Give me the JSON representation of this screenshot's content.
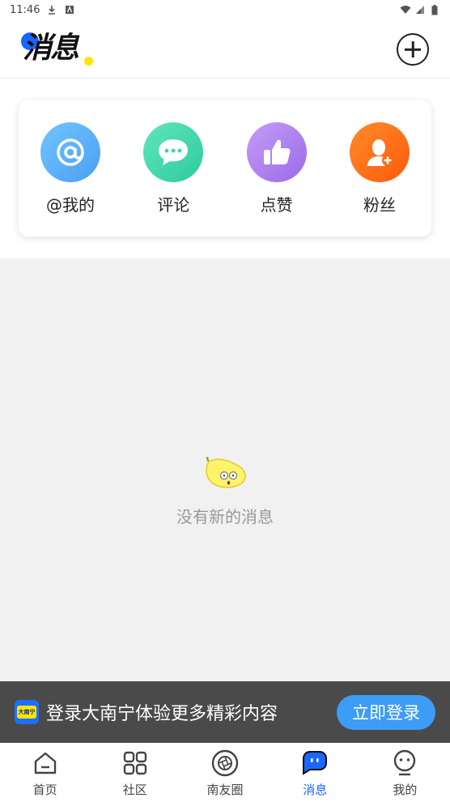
{
  "status_bar": {
    "time": "11:46"
  },
  "header": {
    "title": "消息",
    "add_icon": "plus-circle-icon"
  },
  "categories": [
    {
      "label": "@我的",
      "icon": "at-icon",
      "color": "#5aaef7"
    },
    {
      "label": "评论",
      "icon": "comment-bubble-icon",
      "color": "#3fd6a9"
    },
    {
      "label": "点赞",
      "icon": "thumbs-up-icon",
      "color": "#b07ef0"
    },
    {
      "label": "粉丝",
      "icon": "user-add-icon",
      "color": "#ff6a13"
    }
  ],
  "empty_state": {
    "text": "没有新的消息",
    "icon": "lemon-mascot-icon"
  },
  "login_banner": {
    "text": "登录大南宁体验更多精彩内容",
    "button": "立即登录",
    "logo_text": "大南宁"
  },
  "tabs": [
    {
      "label": "首页",
      "icon": "home-icon"
    },
    {
      "label": "社区",
      "icon": "grid-icon"
    },
    {
      "label": "南友圈",
      "icon": "aperture-icon"
    },
    {
      "label": "消息",
      "icon": "message-icon",
      "active": true
    },
    {
      "label": "我的",
      "icon": "face-icon"
    }
  ],
  "colors": {
    "accent": "#1a66ff",
    "login_button": "#3d9cf5",
    "banner_bg": "#4a4a4a"
  }
}
